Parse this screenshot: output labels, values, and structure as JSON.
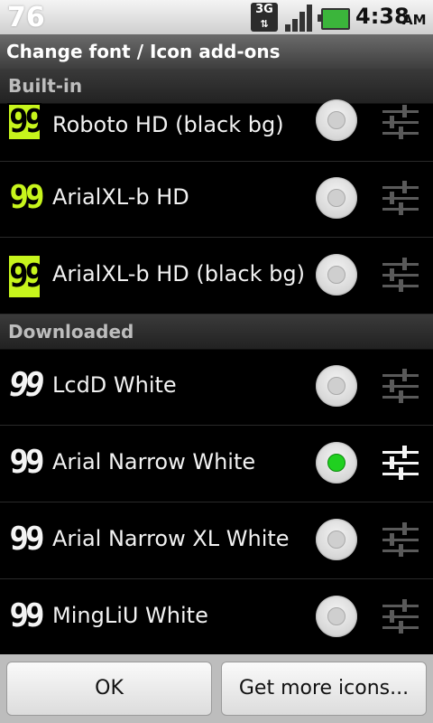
{
  "status_bar": {
    "left_number": "76",
    "network": "3G",
    "time": "4:38",
    "ampm": "AM"
  },
  "title": "Change font / Icon add-ons",
  "sections": [
    {
      "header": "Built-in",
      "items": [
        {
          "icon_text": "99",
          "label": "Roboto HD (black bg)",
          "selected": false
        },
        {
          "icon_text": "99",
          "label": "ArialXL-b HD",
          "selected": false
        },
        {
          "icon_text": "99",
          "label": "ArialXL-b HD (black bg)",
          "selected": false
        }
      ]
    },
    {
      "header": "Downloaded",
      "items": [
        {
          "icon_text": "99",
          "label": "LcdD White",
          "selected": false
        },
        {
          "icon_text": "99",
          "label": "Arial Narrow White",
          "selected": true
        },
        {
          "icon_text": "99",
          "label": "Arial Narrow XL White",
          "selected": false
        },
        {
          "icon_text": "99",
          "label": "MingLiU White",
          "selected": false
        }
      ]
    }
  ],
  "buttons": {
    "ok": "OK",
    "more": "Get more icons..."
  },
  "colors": {
    "accent_icon": "#c7f51c",
    "selected_radio": "#20d020"
  },
  "icons": {
    "settings": "sliders-icon",
    "battery": "battery-icon",
    "signal": "signal-icon"
  }
}
